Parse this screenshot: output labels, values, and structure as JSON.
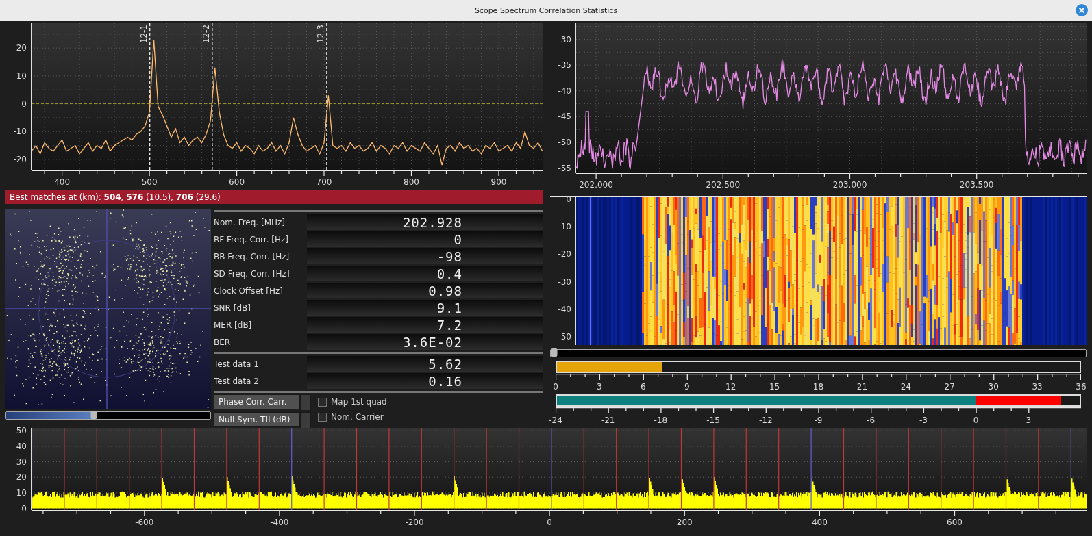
{
  "window": {
    "title": "Scope Spectrum Correlation Statistics"
  },
  "correlation_plot": {
    "chart_data": {
      "type": "line",
      "xlim": [
        365,
        951
      ],
      "ylim": [
        -23.7,
        28.9
      ],
      "xticks": [
        400,
        500,
        600,
        700,
        800,
        900
      ],
      "yticks": [
        20,
        10,
        0,
        -10,
        -20
      ],
      "x": [
        365,
        370,
        375,
        380,
        385,
        390,
        395,
        400,
        405,
        410,
        415,
        420,
        425,
        430,
        435,
        440,
        445,
        450,
        455,
        460,
        465,
        470,
        475,
        480,
        485,
        490,
        495,
        500,
        505,
        510,
        515,
        520,
        525,
        530,
        535,
        540,
        545,
        550,
        555,
        560,
        565,
        570,
        575,
        580,
        585,
        590,
        595,
        600,
        605,
        610,
        615,
        620,
        625,
        630,
        635,
        640,
        645,
        650,
        655,
        660,
        665,
        670,
        675,
        680,
        685,
        690,
        695,
        700,
        705,
        710,
        715,
        720,
        725,
        730,
        735,
        740,
        745,
        750,
        755,
        760,
        765,
        770,
        775,
        780,
        785,
        790,
        795,
        800,
        805,
        810,
        815,
        820,
        825,
        830,
        835,
        840,
        845,
        850,
        855,
        860,
        865,
        870,
        875,
        880,
        885,
        890,
        895,
        900,
        905,
        910,
        915,
        920,
        925,
        930,
        935,
        940,
        945,
        950
      ],
      "series": [
        {
          "color": "#ffbb6e",
          "values": [
            -17,
            -15,
            -18,
            -14,
            -16,
            -17,
            -15,
            -13,
            -17,
            -16,
            -15,
            -18,
            -16,
            -14,
            -17,
            -15,
            -16,
            -13,
            -17,
            -15,
            -14,
            -13,
            -12,
            -13,
            -11,
            -10,
            -8,
            -3,
            23,
            -1,
            -4,
            -8,
            -12,
            -9,
            -14,
            -12,
            -15,
            -13,
            -12,
            -14,
            -11,
            -6,
            13,
            -3,
            -11,
            -15,
            -16,
            -14,
            -17,
            -15,
            -16,
            -18,
            -15,
            -17,
            -16,
            -14,
            -17,
            -15,
            -18,
            -14,
            -5,
            -11,
            -15,
            -17,
            -16,
            -15,
            -18,
            -14,
            3,
            -15,
            -16,
            -15,
            -17,
            -14,
            -16,
            -15,
            -17,
            -16,
            -14,
            -17,
            -15,
            -16,
            -18,
            -15,
            -16,
            -14,
            -17,
            -15,
            -16,
            -17,
            -14,
            -16,
            -18,
            -15,
            -22,
            -16,
            -15,
            -17,
            -14,
            -16,
            -15,
            -17,
            -16,
            -18,
            -15,
            -16,
            -14,
            -17,
            -16,
            -15,
            -17,
            -14,
            -16,
            -10,
            -15,
            -16,
            -14,
            -17
          ]
        }
      ],
      "grid": true,
      "ref_lines": [
        {
          "axis": "y",
          "value": 0
        },
        {
          "axis": "x",
          "value": 500.5
        },
        {
          "axis": "x",
          "value": 572
        },
        {
          "axis": "x",
          "value": 703
        }
      ],
      "annotations": [
        "12-1",
        "12-2",
        "12-3"
      ]
    }
  },
  "best_matches": "Best matches at (km): **504**, **576** (10.5), **706** (29.6)",
  "constellation_slider": {
    "level": 0.43
  },
  "stat_groups": [
    {
      "rows": [
        {
          "label": "Nom. Freq. [MHz]",
          "value": "202.928"
        },
        {
          "label": "RF Freq. Corr. [Hz]",
          "value": "0"
        },
        {
          "label": "BB Freq. Corr. [Hz]",
          "value": "-98"
        },
        {
          "label": "SD Freq. Corr. [Hz]",
          "value": "0.4"
        },
        {
          "label": "Clock Offset [Hz]",
          "value": "0.98"
        },
        {
          "label": "SNR [dB]",
          "value": "9.1"
        },
        {
          "label": "MER [dB]",
          "value": "7.2"
        },
        {
          "label": "BER",
          "value": "3.6E-02"
        }
      ]
    },
    {
      "rows": [
        {
          "label": "Test data 1",
          "value": "5.62"
        },
        {
          "label": "Test data 2",
          "value": "0.16"
        }
      ]
    }
  ],
  "buttons": [
    {
      "label": "Phase Corr. Carr."
    },
    {
      "label": "Null Sym. TII (dB)"
    }
  ],
  "checkboxes": [
    {
      "label": "Map 1st quad",
      "checked": false
    },
    {
      "label": "Nom. Carrier",
      "checked": false
    }
  ],
  "spectrum": {
    "y_ticks": [
      "-30",
      "-35",
      "-40",
      "-45",
      "-50",
      "-55"
    ],
    "x_ticks": [
      "202.000",
      "202.500",
      "203.000",
      "203.500"
    ]
  },
  "waterfall": {
    "y_ticks": [
      "0",
      "-10",
      "-20",
      "-30",
      "-40",
      "-50"
    ]
  },
  "waterfall_slider": {
    "level": 0
  },
  "meters": [
    {
      "kind": "single",
      "level": 0.2,
      "ticks": [
        "0",
        "3",
        "6",
        "9",
        "12",
        "15",
        "18",
        "21",
        "24",
        "27",
        "30",
        "33",
        "36"
      ]
    },
    {
      "kind": "split",
      "level": 0.964,
      "ticks": [
        "-24",
        "-21",
        "-18",
        "-15",
        "-12",
        "-9",
        "-6",
        "-3",
        "0",
        "3"
      ]
    }
  ],
  "tii_plot": {
    "y_ticks": [
      "50",
      "40",
      "30",
      "20",
      "10",
      "0"
    ],
    "x_ticks": [
      "-600",
      "-400",
      "-200",
      "0",
      "200",
      "400",
      "600"
    ]
  }
}
